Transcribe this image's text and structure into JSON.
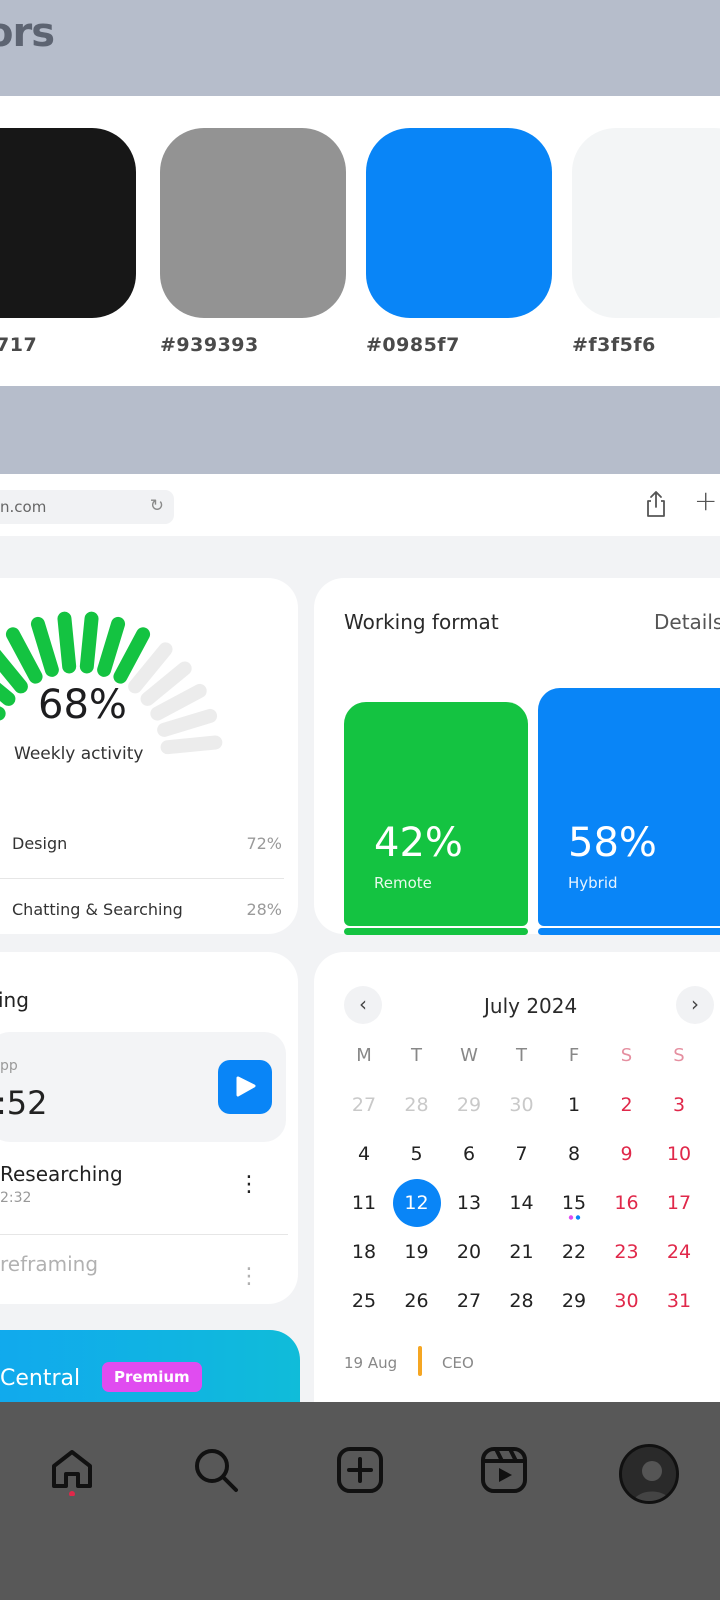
{
  "palette": {
    "title_fragment": "ors",
    "swatches": [
      {
        "color": "#171717",
        "label": "717"
      },
      {
        "color": "#939393",
        "label": "#939393"
      },
      {
        "color": "#0985f7",
        "label": "#0985f7"
      },
      {
        "color": "#f3f5f6",
        "label": "#f3f5f6"
      }
    ]
  },
  "browser": {
    "url": "n.com",
    "icons": [
      "reload-icon",
      "share-icon",
      "plus-icon"
    ]
  },
  "activity": {
    "percent": "68%",
    "percent_value": 68,
    "label": "Weekly activity",
    "rows": [
      {
        "name": "Design",
        "pct": "72%"
      },
      {
        "name": "Chatting & Searching",
        "pct": "28%"
      }
    ]
  },
  "working_format": {
    "title": "Working format",
    "details": "Details",
    "bars": [
      {
        "pct": "42%",
        "label": "Remote",
        "value": 42,
        "color": "#14c341"
      },
      {
        "pct": "58%",
        "label": "Hybrid",
        "value": 58,
        "color": "#0985f7"
      }
    ]
  },
  "focus": {
    "title": "ing",
    "timer_app": "pp",
    "timer_value": ":52",
    "tasks": [
      {
        "name": "Researching",
        "time": "2:32"
      },
      {
        "name": "reframing",
        "time": ""
      }
    ]
  },
  "central": {
    "name": "Central",
    "badge": "Premium"
  },
  "calendar": {
    "month": "July 2024",
    "prev": "‹",
    "next": "›",
    "weekdays": [
      "M",
      "T",
      "W",
      "T",
      "F",
      "S",
      "S"
    ],
    "weeks": [
      [
        "27",
        "28",
        "29",
        "30",
        "1",
        "2",
        "3"
      ],
      [
        "4",
        "5",
        "6",
        "7",
        "8",
        "9",
        "10"
      ],
      [
        "11",
        "12",
        "13",
        "14",
        "15",
        "16",
        "17"
      ],
      [
        "18",
        "19",
        "20",
        "21",
        "22",
        "23",
        "24"
      ],
      [
        "25",
        "26",
        "27",
        "28",
        "29",
        "30",
        "31"
      ]
    ],
    "today": "12",
    "event": {
      "date": "19 Aug",
      "role": "CEO"
    }
  },
  "bottom_nav": {
    "items": [
      "home-icon",
      "search-icon",
      "create-icon",
      "reels-icon",
      "profile-avatar"
    ]
  }
}
